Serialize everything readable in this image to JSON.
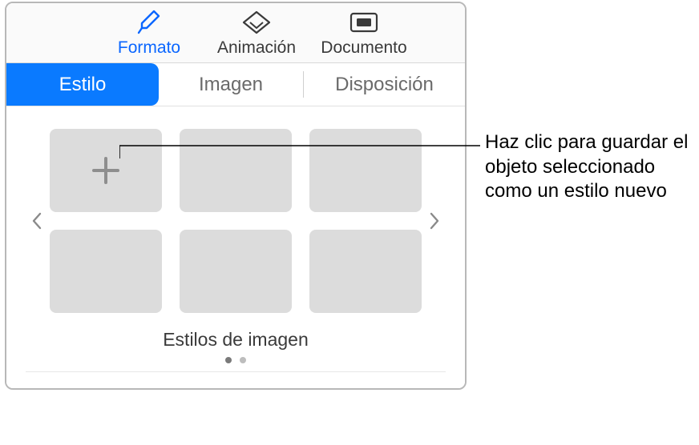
{
  "toolbar": {
    "format": "Formato",
    "animation": "Animación",
    "document": "Documento"
  },
  "segment": {
    "style": "Estilo",
    "image": "Imagen",
    "arrange": "Disposición"
  },
  "styles": {
    "caption": "Estilos de imagen"
  },
  "callout": {
    "text": "Haz clic para guardar el objeto seleccionado como un estilo nuevo"
  }
}
